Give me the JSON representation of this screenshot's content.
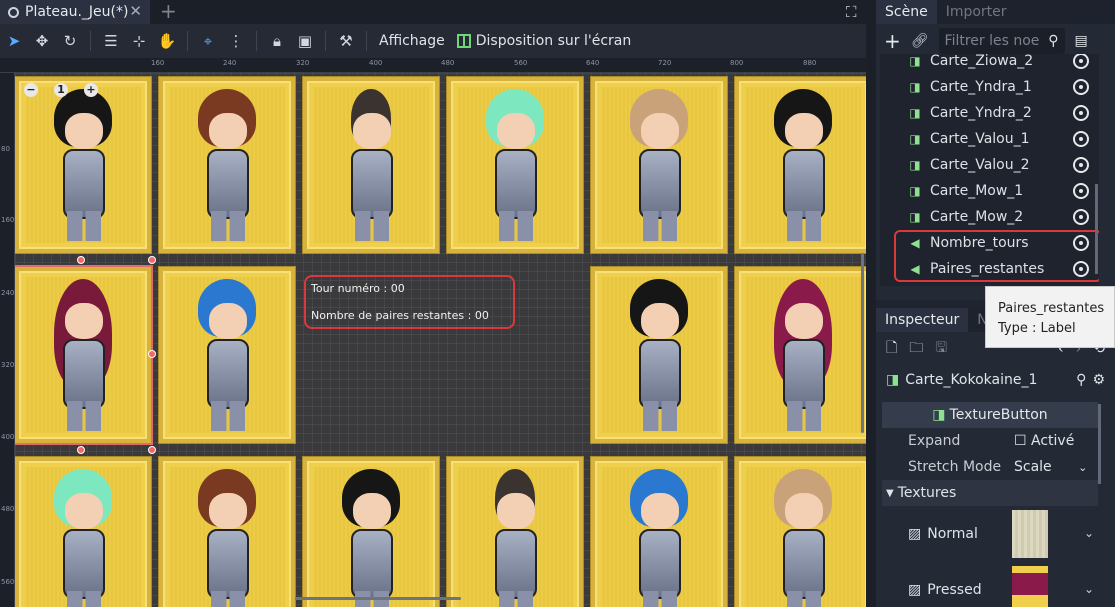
{
  "tab": {
    "title": "Plateau._Jeu(*)",
    "close": "✕",
    "add": "+"
  },
  "toolbar": {
    "view_label": "Affichage",
    "layout_label": "Disposition sur l'écran"
  },
  "ruler": {
    "top": [
      "160",
      "240",
      "320",
      "400",
      "480",
      "560",
      "640",
      "720",
      "800",
      "880"
    ],
    "left": [
      "80",
      "160",
      "240",
      "320",
      "400",
      "480",
      "560"
    ]
  },
  "canvas": {
    "zoom_out": "−",
    "zoom_reset": "1",
    "zoom_in": "+",
    "label_turn": "Tour numéro : 00",
    "label_pairs": "Nombre de paires restantes : 00"
  },
  "scene": {
    "tab_scene": "Scène",
    "tab_import": "Importer",
    "filter_placeholder": "Filtrer les noe",
    "nodes": [
      {
        "name": "Carte_Ziowa_2",
        "type": "texture"
      },
      {
        "name": "Carte_Yndra_1",
        "type": "texture"
      },
      {
        "name": "Carte_Yndra_2",
        "type": "texture"
      },
      {
        "name": "Carte_Valou_1",
        "type": "texture"
      },
      {
        "name": "Carte_Valou_2",
        "type": "texture"
      },
      {
        "name": "Carte_Mow_1",
        "type": "texture"
      },
      {
        "name": "Carte_Mow_2",
        "type": "texture"
      },
      {
        "name": "Nombre_tours",
        "type": "label"
      },
      {
        "name": "Paires_restantes",
        "type": "label"
      }
    ]
  },
  "tooltip": {
    "line1": "Paires_restantes",
    "line2": "Type : Label"
  },
  "inspector": {
    "tab_inspector": "Inspecteur",
    "tab_node": "N",
    "node_name": "Carte_Kokokaine_1",
    "class_name": "TextureButton",
    "props": [
      {
        "label": "Expand",
        "value": "Activé"
      },
      {
        "label": "Stretch Mode",
        "value": "Scale"
      }
    ],
    "section": "Textures",
    "textures": [
      {
        "label": "Normal"
      },
      {
        "label": "Pressed"
      }
    ]
  },
  "colors": {
    "highlight": "#d9393b",
    "card": "#efcf4c",
    "node_icon": "#8ee28f"
  }
}
